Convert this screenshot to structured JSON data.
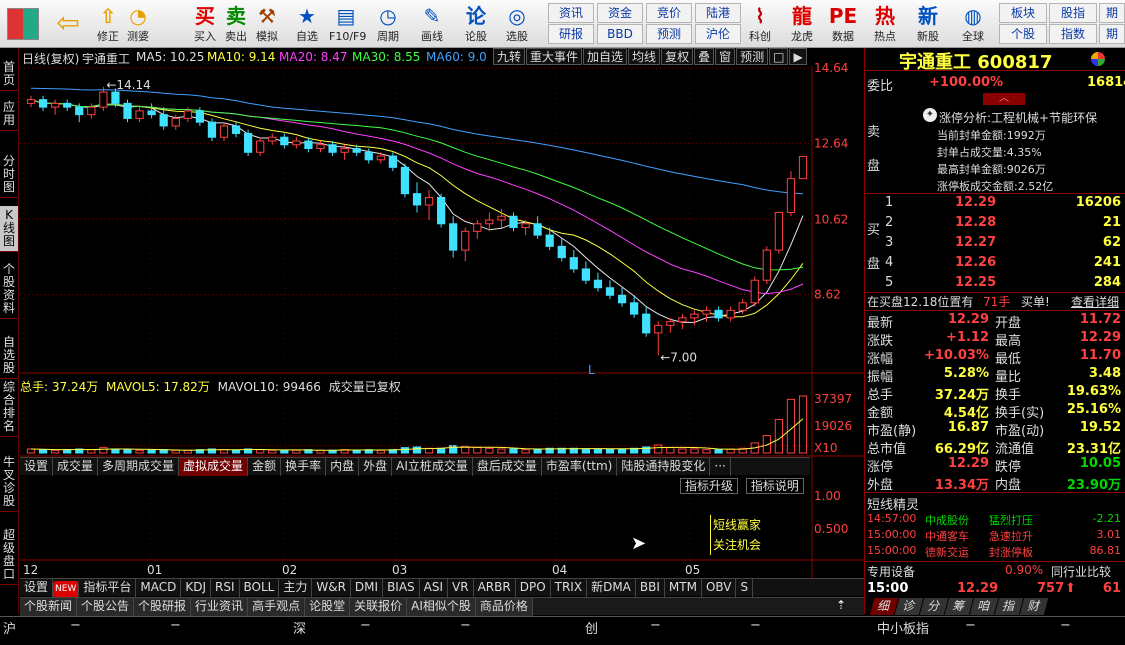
{
  "toolbar": {
    "big": [
      {
        "label": "修正",
        "icon": "arrow-up-icon"
      },
      {
        "label": "测婆",
        "icon": "clock-icon"
      },
      {
        "label": "买入",
        "icon": "buy-icon"
      },
      {
        "label": "卖出",
        "icon": "sell-icon"
      },
      {
        "label": "模拟",
        "icon": "hammer-icon"
      },
      {
        "label": "自选",
        "icon": "star-icon"
      },
      {
        "label": "F10/F9",
        "icon": "doc-icon"
      },
      {
        "label": "周期",
        "icon": "clock2-icon"
      },
      {
        "label": "画线",
        "icon": "pen-icon"
      },
      {
        "label": "论股",
        "icon": "lun-icon"
      },
      {
        "label": "选股",
        "icon": "magnifier-icon"
      },
      {
        "label": "科创",
        "icon": "chart-icon"
      },
      {
        "label": "龙虎",
        "icon": "dragon-icon"
      },
      {
        "label": "数据",
        "icon": "pe-icon"
      },
      {
        "label": "热点",
        "icon": "hot-icon"
      },
      {
        "label": "新股",
        "icon": "new-icon"
      },
      {
        "label": "全球",
        "icon": "globe-icon"
      }
    ],
    "small_top": [
      "资讯",
      "资金",
      "竞价",
      "陆港"
    ],
    "small_bot": [
      "研报",
      "BBD",
      "预测",
      "沪伦"
    ],
    "right_top": [
      "板块",
      "股指",
      "期"
    ],
    "right_bot": [
      "个股",
      "指数",
      "期"
    ]
  },
  "sidebar": [
    "首页",
    "应用",
    "分时图",
    "K线图",
    "个股资料",
    "自选股",
    "综合排名",
    "牛叉诊股",
    "超级盘口"
  ],
  "header": {
    "title": "日线(复权)",
    "name": "宇通重工",
    "ma5": "MA5: 10.25",
    "ma10": "MA10: 9.14",
    "ma20": "MA20: 8.47",
    "ma30": "MA30: 8.55",
    "ma60": "MA60: 9.0",
    "buttons": [
      "九转",
      "重大事件",
      "加自选",
      "均线",
      "复权",
      "叠",
      "窗",
      "预测",
      "□",
      "▶"
    ]
  },
  "price_axis": [
    "14.64",
    "12.64",
    "10.62",
    "8.62"
  ],
  "annotations": {
    "high": "14.14",
    "low": "7.00",
    "mark": "L"
  },
  "volume": {
    "label": "总手: 37.24万",
    "mavol5": "MAVOL5: 17.82万",
    "mavol10": "MAVOL10: 99466",
    "note": "成交量已复权",
    "axis": [
      "37397",
      "19026",
      "X10"
    ]
  },
  "vol_tabs": [
    "设置",
    "成交量",
    "多周期成交量",
    "虚拟成交量",
    "金额",
    "换手率",
    "内盘",
    "外盘",
    "AI立桩成交量",
    "盘后成交量",
    "市盈率(ttm)",
    "陆股通持股变化",
    "···"
  ],
  "ind": {
    "btn1": "指标升级",
    "btn2": "指标说明",
    "axis": [
      "1.00",
      "0.500"
    ],
    "text1": "短线赢家",
    "text2": "关注机会"
  },
  "months": [
    "12",
    "01",
    "02",
    "03",
    "04",
    "05"
  ],
  "ind_tabs": [
    "设置",
    "NEW",
    "指标平台",
    "MACD",
    "KDJ",
    "RSI",
    "BOLL",
    "主力",
    "W&R",
    "DMI",
    "BIAS",
    "ASI",
    "VR",
    "ARBR",
    "DPO",
    "TRIX",
    "新DMA",
    "BBI",
    "MTM",
    "OBV",
    "S"
  ],
  "news_tabs": [
    "个股新闻",
    "个股公告",
    "个股研报",
    "行业资讯",
    "高手观点",
    "论股堂",
    "关联报价",
    "AI相似个股",
    "商品价格"
  ],
  "right": {
    "stock": "宇通重工 600817",
    "weibi_label": "委比",
    "weibi": "+100.00%",
    "weibi_vol": "16814",
    "sell": "卖盘",
    "buy": "买盘",
    "limit": {
      "title": "涨停分析:工程机械+节能环保",
      "l1": "当前封单金额:1992万",
      "l2": "封单占成交量:4.35%",
      "l3": "最高封单金额:9026万",
      "l4": "涨停板成交金额:2.52亿"
    },
    "bids": [
      {
        "n": "1",
        "p": "12.29",
        "v": "16206"
      },
      {
        "n": "2",
        "p": "12.28",
        "v": "21"
      },
      {
        "n": "3",
        "p": "12.27",
        "v": "62"
      },
      {
        "n": "4",
        "p": "12.26",
        "v": "241"
      },
      {
        "n": "5",
        "p": "12.25",
        "v": "284"
      }
    ],
    "inbuy": "在买盘12.18位置有",
    "inbuy_v": "71手",
    "inbuy_t": "买单!",
    "detail": "查看详细",
    "q": [
      [
        "最新",
        "12.29",
        "开盘",
        "11.72"
      ],
      [
        "涨跌",
        "+1.12",
        "最高",
        "12.29"
      ],
      [
        "涨幅",
        "+10.03%",
        "最低",
        "11.70"
      ],
      [
        "振幅",
        "5.28%",
        "量比",
        "3.48"
      ],
      [
        "总手",
        "37.24万",
        "换手",
        "19.63%"
      ],
      [
        "金额",
        "4.54亿",
        "换手(实)",
        "25.16%"
      ],
      [
        "市盈(静)",
        "16.87",
        "市盈(动)",
        "19.52"
      ],
      [
        "总市值",
        "66.29亿",
        "流通值",
        "23.31亿"
      ],
      [
        "涨停",
        "12.29",
        "跌停",
        "10.05"
      ],
      [
        "外盘",
        "13.34万",
        "内盘",
        "23.90万"
      ]
    ],
    "sprite": "短线精灵",
    "sprites": [
      {
        "t": "14:57:00",
        "n": "中成股份",
        "e": "猛烈打压",
        "v": "-2.21"
      },
      {
        "t": "15:00:00",
        "n": "中通客车",
        "e": "急速拉升",
        "v": "3.01"
      },
      {
        "t": "15:00:00",
        "n": "德新交运",
        "e": "封涨停板",
        "v": "86.81"
      }
    ],
    "dev": "专用设备",
    "dev_v": "0.90%",
    "industry": "同行业比较",
    "tick": {
      "t": "15:00",
      "p": "12.29",
      "v": "757",
      "x": "61"
    },
    "tabs": [
      "细",
      "诊",
      "分",
      "筹",
      "咱",
      "指",
      "财"
    ]
  },
  "status": {
    "a": "沪",
    "b": "深",
    "c": "创",
    "d": "中小板指",
    "dash": "−"
  },
  "chart_data": {
    "type": "candlestick",
    "x": [
      "12",
      "01",
      "02",
      "03",
      "04",
      "05"
    ],
    "ylim": [
      6.8,
      14.64
    ],
    "high_label": 14.14,
    "low_label": 7.0,
    "candles": [
      [
        13.7,
        13.9,
        13.6,
        13.8
      ],
      [
        13.8,
        13.9,
        13.5,
        13.6
      ],
      [
        13.6,
        13.8,
        13.4,
        13.7
      ],
      [
        13.7,
        13.8,
        13.5,
        13.6
      ],
      [
        13.6,
        13.7,
        13.2,
        13.4
      ],
      [
        13.4,
        13.7,
        13.3,
        13.6
      ],
      [
        13.6,
        14.14,
        13.5,
        14.0
      ],
      [
        14.0,
        14.1,
        13.6,
        13.7
      ],
      [
        13.7,
        13.8,
        13.2,
        13.3
      ],
      [
        13.3,
        13.6,
        13.2,
        13.5
      ],
      [
        13.5,
        13.7,
        13.3,
        13.4
      ],
      [
        13.4,
        13.6,
        13.0,
        13.1
      ],
      [
        13.1,
        13.4,
        13.0,
        13.3
      ],
      [
        13.3,
        13.6,
        13.2,
        13.5
      ],
      [
        13.5,
        13.6,
        13.1,
        13.2
      ],
      [
        13.2,
        13.3,
        12.7,
        12.8
      ],
      [
        12.8,
        13.2,
        12.7,
        13.1
      ],
      [
        13.1,
        13.2,
        12.8,
        12.9
      ],
      [
        12.9,
        13.0,
        12.3,
        12.4
      ],
      [
        12.4,
        12.8,
        12.3,
        12.7
      ],
      [
        12.7,
        12.9,
        12.6,
        12.8
      ],
      [
        12.8,
        12.9,
        12.5,
        12.6
      ],
      [
        12.6,
        12.8,
        12.5,
        12.7
      ],
      [
        12.7,
        12.8,
        12.4,
        12.5
      ],
      [
        12.5,
        12.7,
        12.4,
        12.6
      ],
      [
        12.6,
        12.7,
        12.3,
        12.4
      ],
      [
        12.4,
        12.6,
        12.2,
        12.5
      ],
      [
        12.5,
        12.6,
        12.3,
        12.4
      ],
      [
        12.4,
        12.5,
        12.1,
        12.2
      ],
      [
        12.2,
        12.4,
        12.1,
        12.3
      ],
      [
        12.3,
        12.4,
        11.9,
        12.0
      ],
      [
        12.0,
        12.1,
        11.2,
        11.3
      ],
      [
        11.3,
        11.6,
        10.8,
        11.0
      ],
      [
        11.0,
        11.4,
        10.6,
        11.2
      ],
      [
        11.2,
        11.3,
        10.4,
        10.5
      ],
      [
        10.5,
        10.7,
        9.6,
        9.8
      ],
      [
        9.8,
        10.4,
        9.5,
        10.3
      ],
      [
        10.3,
        10.6,
        10.1,
        10.5
      ],
      [
        10.5,
        10.8,
        10.3,
        10.6
      ],
      [
        10.6,
        10.9,
        10.4,
        10.7
      ],
      [
        10.7,
        10.8,
        10.3,
        10.4
      ],
      [
        10.4,
        10.6,
        10.2,
        10.5
      ],
      [
        10.5,
        10.7,
        10.1,
        10.2
      ],
      [
        10.2,
        10.4,
        9.8,
        9.9
      ],
      [
        9.9,
        10.1,
        9.5,
        9.6
      ],
      [
        9.6,
        9.8,
        9.2,
        9.3
      ],
      [
        9.3,
        9.5,
        8.9,
        9.0
      ],
      [
        9.0,
        9.2,
        8.7,
        8.8
      ],
      [
        8.8,
        9.0,
        8.5,
        8.6
      ],
      [
        8.6,
        8.8,
        8.3,
        8.4
      ],
      [
        8.4,
        8.6,
        8.0,
        8.1
      ],
      [
        8.1,
        8.3,
        7.5,
        7.6
      ],
      [
        7.6,
        7.9,
        7.0,
        7.8
      ],
      [
        7.8,
        8.0,
        7.6,
        7.9
      ],
      [
        7.9,
        8.1,
        7.7,
        8.0
      ],
      [
        8.0,
        8.2,
        7.8,
        8.1
      ],
      [
        8.1,
        8.3,
        7.9,
        8.2
      ],
      [
        8.2,
        8.3,
        7.9,
        8.0
      ],
      [
        8.0,
        8.3,
        7.9,
        8.2
      ],
      [
        8.2,
        8.5,
        8.1,
        8.4
      ],
      [
        8.4,
        9.1,
        8.3,
        9.0
      ],
      [
        9.0,
        9.9,
        8.9,
        9.8
      ],
      [
        9.8,
        10.8,
        9.7,
        10.8
      ],
      [
        10.8,
        11.9,
        10.7,
        11.7
      ],
      [
        11.7,
        12.29,
        11.7,
        12.29
      ]
    ],
    "volumes": [
      0.6,
      0.5,
      0.4,
      0.5,
      0.6,
      0.5,
      0.8,
      0.6,
      0.5,
      0.4,
      0.4,
      0.5,
      0.4,
      0.4,
      0.5,
      0.6,
      0.5,
      0.4,
      0.6,
      0.5,
      0.4,
      0.4,
      0.4,
      0.5,
      0.4,
      0.4,
      0.5,
      0.4,
      0.5,
      0.4,
      0.5,
      0.8,
      0.9,
      0.7,
      0.7,
      1.1,
      1.0,
      0.8,
      0.7,
      0.6,
      0.6,
      0.5,
      0.6,
      0.7,
      0.7,
      0.7,
      0.6,
      0.6,
      0.6,
      0.6,
      0.7,
      0.9,
      1.2,
      0.8,
      0.6,
      0.6,
      0.5,
      0.5,
      0.6,
      0.7,
      1.5,
      2.6,
      5.0,
      8.0,
      8.5
    ],
    "vol_ylim": [
      0,
      37397
    ]
  }
}
